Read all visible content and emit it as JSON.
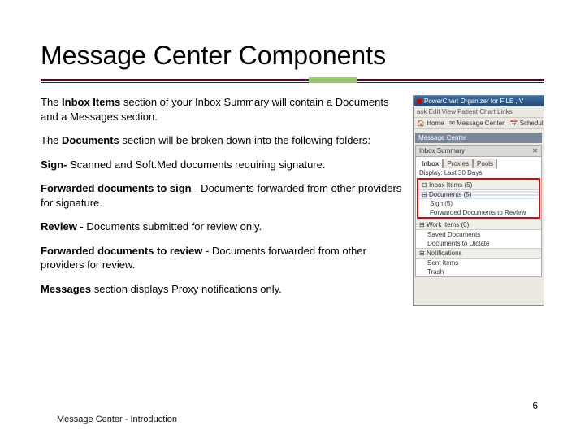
{
  "title": "Message Center Components",
  "paragraphs": {
    "p1_a": "The ",
    "p1_b": "Inbox Items",
    "p1_c": " section of your Inbox Summary will contain a Documents and a Messages section.",
    "p2_a": "The ",
    "p2_b": "Documents",
    "p2_c": " section will be broken down into the following folders:",
    "p3_a": "Sign-",
    "p3_b": " Scanned and Soft.Med documents requiring signature.",
    "p4_a": "Forwarded documents to sign",
    "p4_b": " - Documents forwarded from other providers for signature.",
    "p5_a": "Review",
    "p5_b": " - Documents submitted for review only.",
    "p6_a": "Forwarded documents to review",
    "p6_b": " - Documents forwarded from other providers for review.",
    "p7_a": "Messages",
    "p7_b": " section displays Proxy notifications only."
  },
  "screenshot": {
    "titlebar": "PowerChart Organizer for FILE , V",
    "menubar": "ask  Edit  View  Patient  Chart  Links",
    "toolbar_home": "Home",
    "toolbar_mc": "Message Center",
    "toolbar_sched": "Schedul",
    "section_header": "Message Center",
    "panel_header": "Inbox Summary",
    "tab_inbox": "Inbox",
    "tab_proxies": "Proxies",
    "tab_pools": "Pools",
    "display_label": "Display:",
    "display_value": "Last 30 Days",
    "group_inbox": "Inbox Items (5)",
    "doc_header": "Documents (5)",
    "row_sign": "Sign (5)",
    "row_fwd_review": "Forwarded Documents to Review",
    "group_work": "Work Items (0)",
    "row_saved": "Saved Documents",
    "row_dictate": "Documents to Dictate",
    "group_notif": "Notifications",
    "row_sent": "Sent Items",
    "row_trash": "Trash"
  },
  "footer": "Message Center - Introduction",
  "page_number": "6"
}
